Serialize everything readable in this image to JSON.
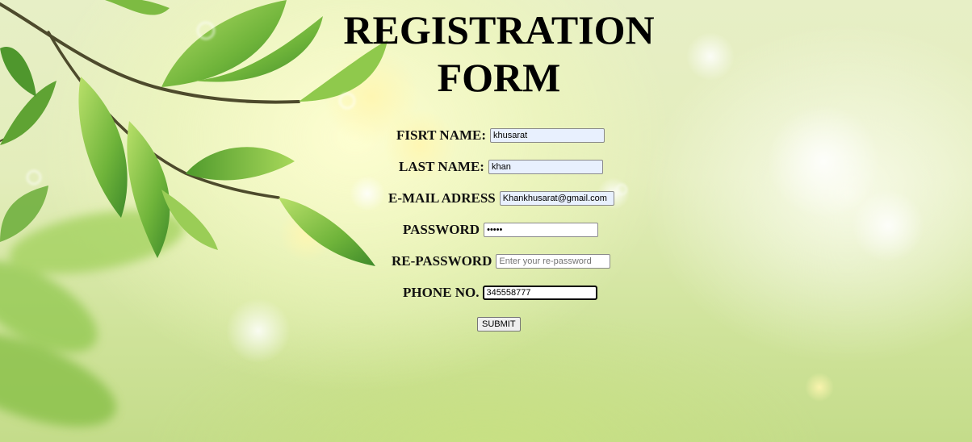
{
  "form": {
    "title_line1": "REGISTRATION",
    "title_line2": "FORM",
    "fields": {
      "first_name": {
        "label": "FISRT NAME:",
        "value": "khusarat"
      },
      "last_name": {
        "label": "LAST NAME:",
        "value": "khan"
      },
      "email": {
        "label": "E-MAIL ADRESS",
        "value": "Khankhusarat@gmail.com"
      },
      "password": {
        "label": "PASSWORD",
        "value": "•••••"
      },
      "re_password": {
        "label": "RE-PASSWORD",
        "placeholder": "Enter your re-password"
      },
      "phone": {
        "label": "PHONE NO.",
        "value": "345558777"
      }
    },
    "submit_label": "SUBMIT"
  },
  "background": {
    "theme": "green-leaves-bokeh",
    "colors": {
      "leaf_dark": "#3f8f2a",
      "leaf_light": "#a7d34a",
      "branch": "#4a4a2a",
      "autofill": "#e8f0fe"
    }
  }
}
